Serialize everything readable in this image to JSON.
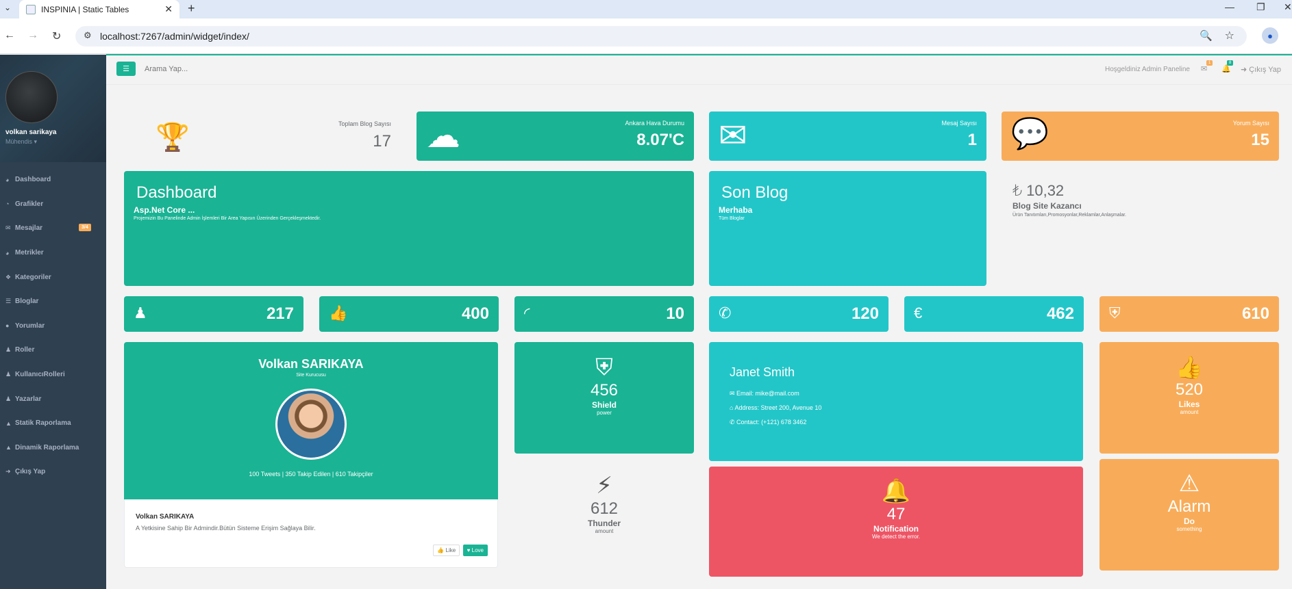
{
  "browser": {
    "tab_title": "INSPINIA | Static Tables",
    "url": "localhost:7267/admin/widget/index/"
  },
  "sidebar": {
    "user_name": "volkan sarikaya",
    "user_role": "Mühendis ▾",
    "items": [
      {
        "label": "Dashboard",
        "icon": "dashboard-icon",
        "glyph": "◕"
      },
      {
        "label": "Grafikler",
        "icon": "chart-icon",
        "glyph": "◔"
      },
      {
        "label": "Mesajlar",
        "icon": "envelope-icon",
        "glyph": "✉",
        "badge": "3/4"
      },
      {
        "label": "Metrikler",
        "icon": "metrics-icon",
        "glyph": "◕"
      },
      {
        "label": "Kategoriler",
        "icon": "users-icon",
        "glyph": "❖"
      },
      {
        "label": "Bloglar",
        "icon": "list-icon",
        "glyph": "☰"
      },
      {
        "label": "Yorumlar",
        "icon": "comment-icon",
        "glyph": "●"
      },
      {
        "label": "Roller",
        "icon": "user-icon",
        "glyph": "♟"
      },
      {
        "label": "KullanıcıRolleri",
        "icon": "user-icon",
        "glyph": "♟"
      },
      {
        "label": "Yazarlar",
        "icon": "user-icon",
        "glyph": "♟"
      },
      {
        "label": "Statik Raporlama",
        "icon": "flask-icon",
        "glyph": "▲"
      },
      {
        "label": "Dinamik Raporlama",
        "icon": "flask-icon",
        "glyph": "▲"
      },
      {
        "label": "Çıkış Yap",
        "icon": "logout-icon",
        "glyph": "➜"
      }
    ]
  },
  "topnav": {
    "search_placeholder": "Arama Yap...",
    "welcome": "Hoşgeldiniz Admin Paneline",
    "mail_count": "1",
    "bell_count": "8",
    "logout": "Çıkış Yap",
    "colors": {
      "mail_badge": "#f8ac59",
      "bell_badge": "#1ab394"
    }
  },
  "stats": {
    "blog_label": "Toplam Blog Sayısı",
    "blog_value": "17",
    "weather_label": "Ankara Hava Durumu",
    "weather_value": "8.07'C",
    "message_label": "Mesaj Sayısı",
    "message_value": "1",
    "comment_label": "Yorum Sayısı",
    "comment_value": "15"
  },
  "dashboard": {
    "title": "Dashboard",
    "subtitle": "Asp.Net Core ...",
    "desc": "Projemizin Bu Panelinde Admin İşlemleri Bir Area Yapısın Üzerinden Gerçekleşmektedir."
  },
  "son_blog": {
    "title": "Son Blog",
    "subtitle": "Merhaba",
    "desc": "Tüm Bloglar"
  },
  "earnings": {
    "value": "₺ 10,32",
    "label": "Blog Site Kazancı",
    "desc": "Ürün Tanıtımları,Promosyonlar,Reklamlar,Anlaşmalar."
  },
  "small_widgets": [
    {
      "icon": "user-icon",
      "glyph": "♟",
      "value": "217",
      "color": "#1ab394"
    },
    {
      "icon": "thumbs-up-icon",
      "glyph": "👍",
      "value": "400",
      "color": "#1ab394"
    },
    {
      "icon": "rss-icon",
      "glyph": "◜",
      "value": "10",
      "color": "#1ab394"
    },
    {
      "icon": "phone-icon",
      "glyph": "✆",
      "value": "120",
      "color": "#23c6c8"
    },
    {
      "icon": "euro-icon",
      "glyph": "€",
      "value": "462",
      "color": "#23c6c8"
    },
    {
      "icon": "shield-icon",
      "glyph": "⛨",
      "value": "610",
      "color": "#f8ac59"
    }
  ],
  "profile": {
    "name": "Volkan SARIKAYA",
    "role": "Site Kurucusu",
    "stats": "100 Tweets | 350 Takip Edilen | 610 Takipçiler",
    "footer_name": "Volkan SARIKAYA",
    "footer_desc": "A Yetkisine Sahip Bir Admindir.Bütün Sisteme Erişim Sağlaya Bilir.",
    "like": "👍 Like",
    "love": "♥ Love"
  },
  "shield": {
    "value": "456",
    "title": "Shield",
    "sub": "power"
  },
  "thunder": {
    "value": "612",
    "title": "Thunder",
    "sub": "amount"
  },
  "contact": {
    "name": "Janet Smith",
    "email": "Email: mike@mail.com",
    "address": "Address: Street 200, Avenue 10",
    "phone": "Contact: (+121) 678 3462"
  },
  "notification": {
    "value": "47",
    "title": "Notification",
    "sub": "We detect the error."
  },
  "likes": {
    "value": "520",
    "title": "Likes",
    "sub": "amount"
  },
  "alarm": {
    "title": "Alarm",
    "bold": "Do",
    "sub": "something"
  }
}
